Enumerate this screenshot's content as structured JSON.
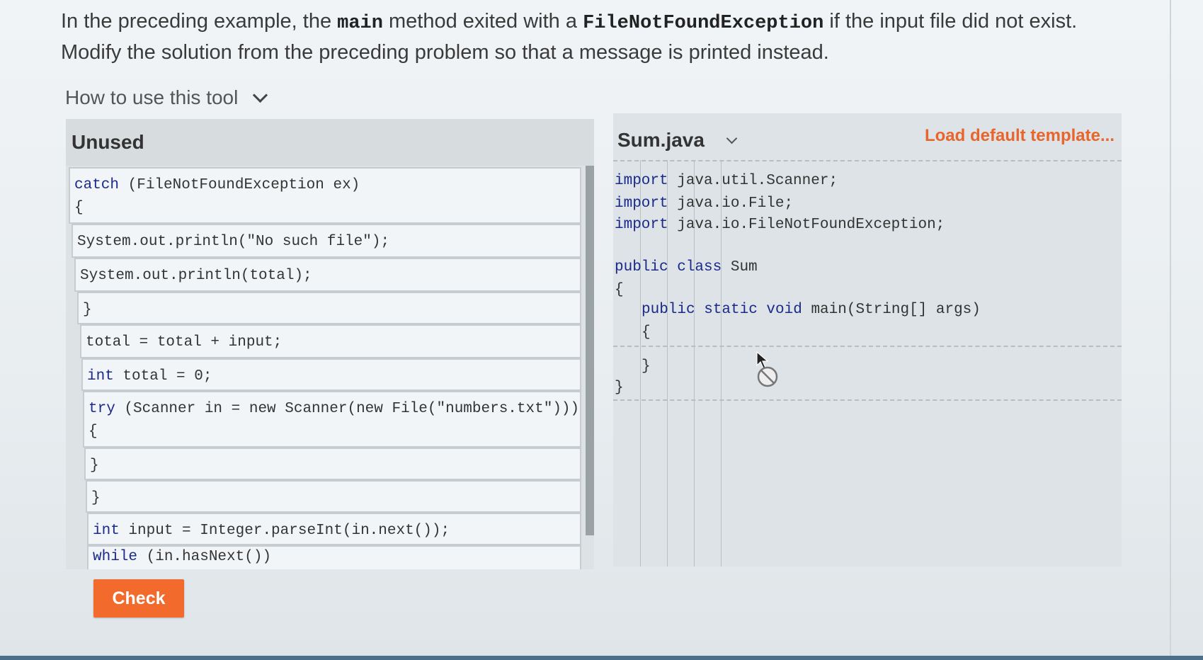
{
  "prompt": {
    "part1": "In the preceding example, the ",
    "code1": "main",
    "part2": " method exited with a ",
    "code2": "FileNotFoundException",
    "part3": " if the input file did not exist. Modify the solution from the preceding problem so that a message is printed instead."
  },
  "howto": {
    "label": "How to use this tool"
  },
  "unused": {
    "title": "Unused",
    "blocks": [
      {
        "kw": "catch",
        "rest": " (FileNotFoundException ex)\n{"
      },
      {
        "kw": "",
        "rest": "System.out.println(\"No such file\");"
      },
      {
        "kw": "",
        "rest": "System.out.println(total);"
      },
      {
        "kw": "",
        "rest": "}"
      },
      {
        "kw": "",
        "rest": "total = total + input;"
      },
      {
        "kw": "int",
        "rest": " total = 0;"
      },
      {
        "kw": "try",
        "rest": " (Scanner in = new Scanner(new File(\"numbers.txt\")))\n{"
      },
      {
        "kw": "",
        "rest": "}"
      },
      {
        "kw": "",
        "rest": "}"
      },
      {
        "kw": "int",
        "rest": " input = Integer.parseInt(in.next());"
      },
      {
        "kw": "while",
        "rest": " (in.hasNext())"
      }
    ]
  },
  "editor": {
    "file_name": "Sum.java",
    "load_label": "Load default template...",
    "lines": [
      {
        "kw": "import",
        "rest": " java.util.Scanner;"
      },
      {
        "kw": "import",
        "rest": " java.io.File;"
      },
      {
        "kw": "import",
        "rest": " java.io.FileNotFoundException;"
      },
      {
        "kw": "public class",
        "rest": " Sum"
      },
      {
        "kw": "",
        "rest": "{"
      },
      {
        "kw": "public static void",
        "rest": " main(String[] args)"
      },
      {
        "kw": "",
        "rest": "{"
      },
      {
        "kw": "",
        "rest": "}"
      },
      {
        "kw": "",
        "rest": "}"
      }
    ]
  },
  "check": {
    "label": "Check"
  },
  "colors": {
    "accent": "#f26a2c",
    "keyword": "#1b2a8a",
    "link": "#e8652c"
  }
}
